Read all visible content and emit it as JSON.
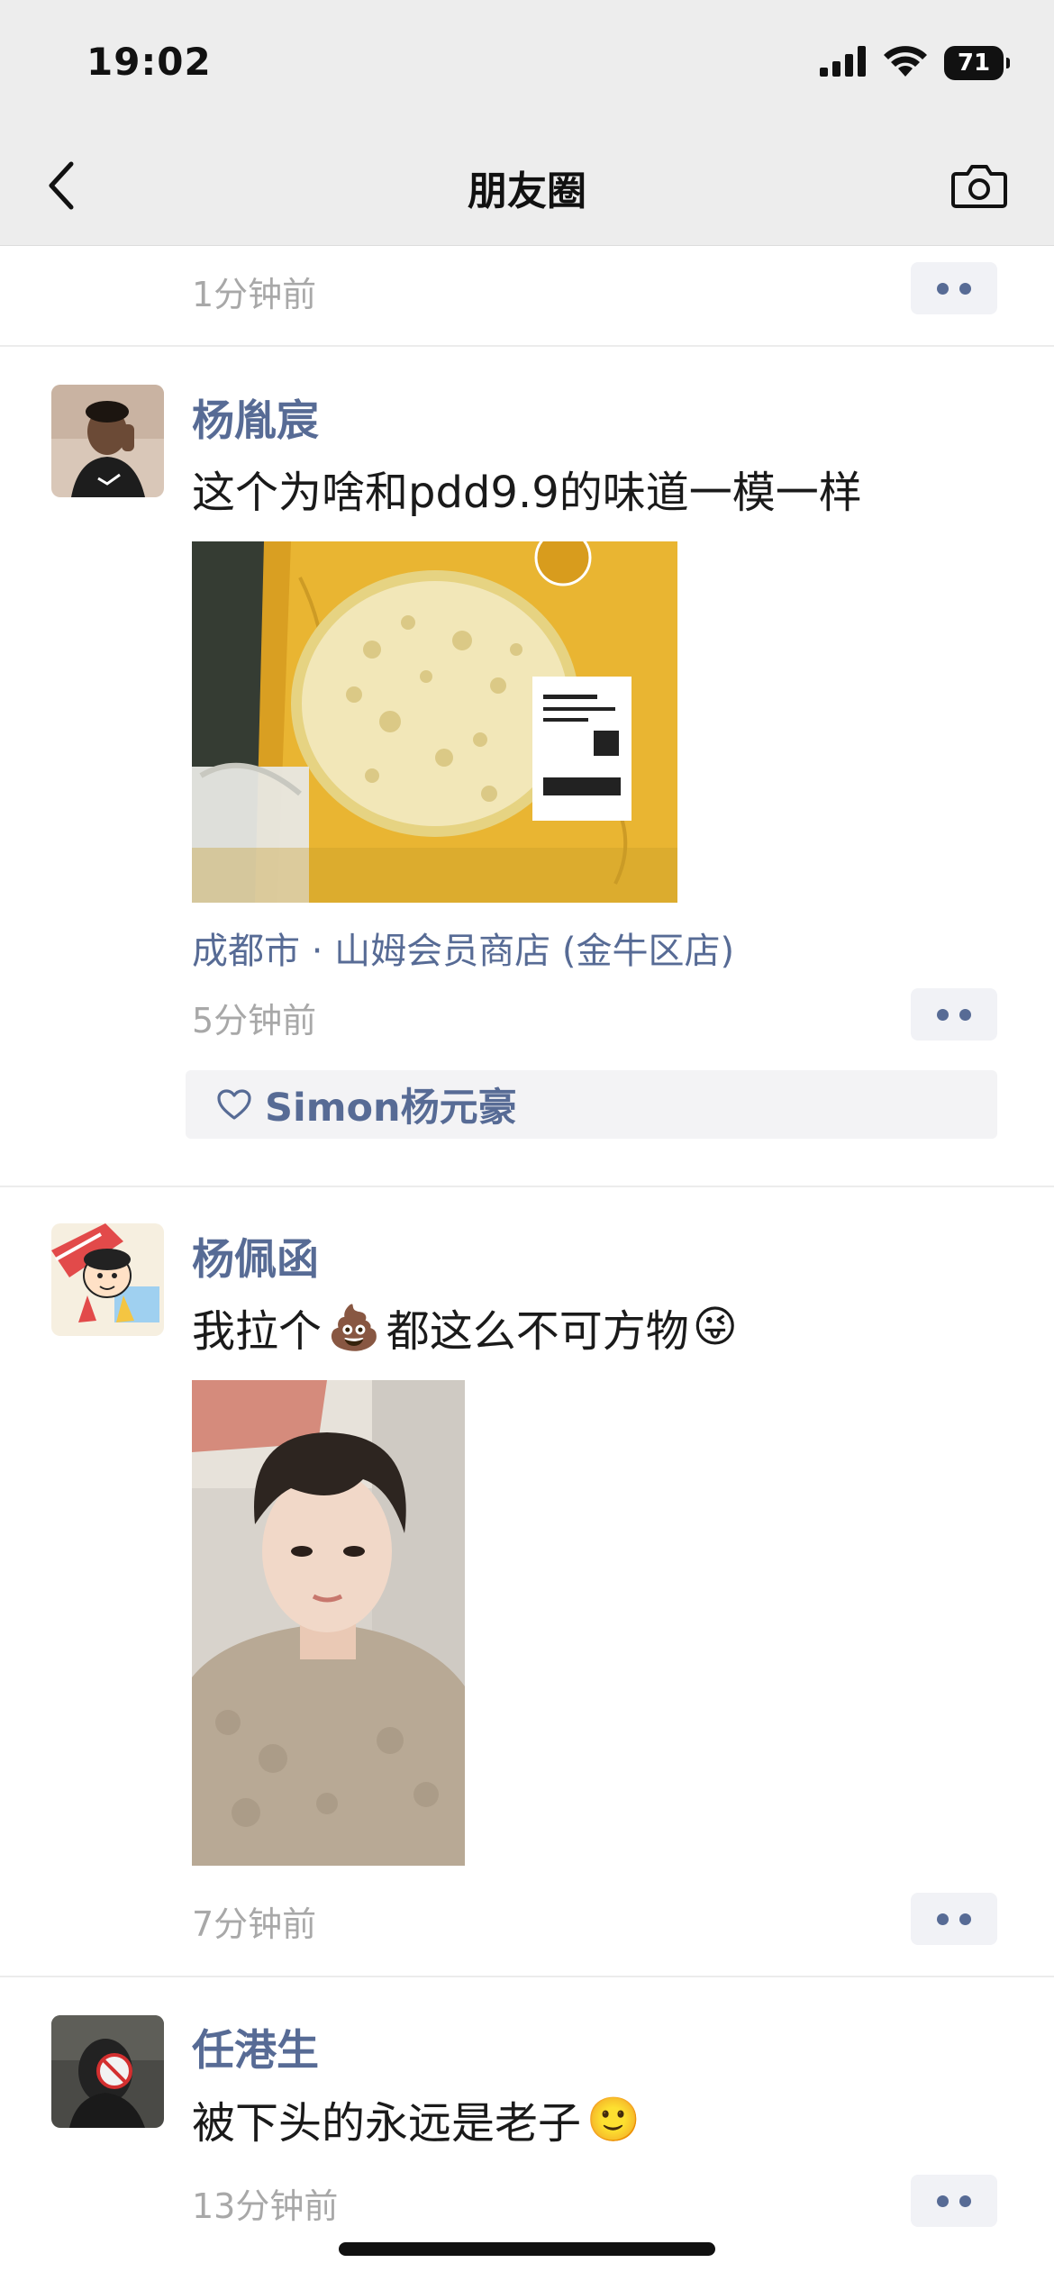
{
  "status_bar": {
    "time": "19:02",
    "battery": "71"
  },
  "nav": {
    "title": "朋友圈"
  },
  "feed": {
    "partial_post": {
      "timestamp": "1分钟前"
    },
    "posts": [
      {
        "author": "杨胤宸",
        "text": "这个为啥和pdd9.9的味道一模一样",
        "location": "成都市 · 山姆会员商店 (金牛区店)",
        "timestamp": "5分钟前",
        "likes": "Simon杨元豪",
        "image": "durian-cake-photo"
      },
      {
        "author": "杨佩函",
        "text_before": "我拉个",
        "emoji_1": "💩",
        "text_after": "都这么不可方物",
        "emoji_2": "😜",
        "timestamp": "7分钟前",
        "image": "selfie-photo"
      },
      {
        "author": "任港生",
        "text": "被下头的永远是老子",
        "emoji": "🙂",
        "timestamp": "13分钟前"
      }
    ]
  },
  "colors": {
    "link_blue": "#576b95",
    "timestamp_gray": "#a8a8a8",
    "nav_background": "#ededed"
  }
}
